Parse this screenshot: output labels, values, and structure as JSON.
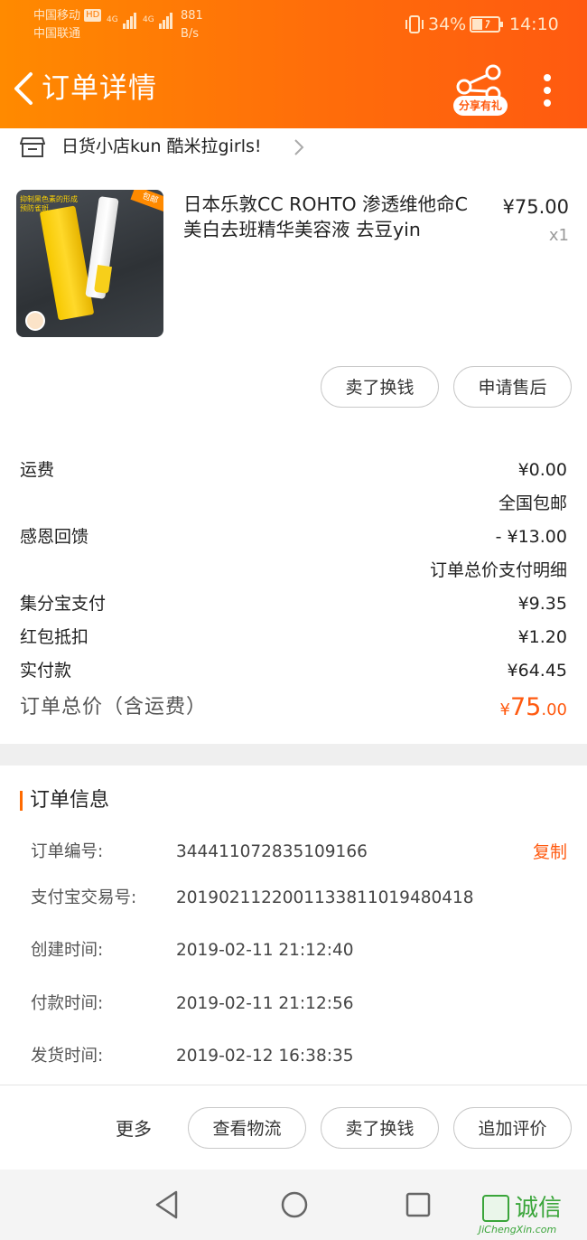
{
  "status_bar": {
    "carrier1": "中国移动",
    "carrier1_badge": "HD",
    "carrier2": "中国联通",
    "net_type1": "4G",
    "net_type2": "4G",
    "speed_value": "881",
    "speed_unit": "B/s",
    "battery": "34%",
    "time": "14:10"
  },
  "header": {
    "title": "订单详情",
    "share_badge": "分享有礼"
  },
  "shop": {
    "name": "日货小店kun 酷米拉girls!"
  },
  "product": {
    "title": "日本乐敦CC ROHTO 渗透维他命C 美白去班精华美容液 去豆yin",
    "price": "¥75.00",
    "qty": "x1",
    "image_text_tag": "抑制黑色素的形成\n预防雀斑",
    "image_corner_tag": "包邮"
  },
  "product_actions": {
    "sell_label": "卖了换钱",
    "aftersale_label": "申请售后"
  },
  "summary": {
    "shipping_label": "运费",
    "shipping_value": "¥0.00",
    "shipping_note": "全国包邮",
    "discount_label": "感恩回馈",
    "discount_value": "- ¥13.00",
    "payment_detail_title": "订单总价支付明细",
    "jifenbao_label": "集分宝支付",
    "jifenbao_value": "¥9.35",
    "hongbao_label": "红包抵扣",
    "hongbao_value": "¥1.20",
    "paid_label": "实付款",
    "paid_value": "¥64.45",
    "total_label": "订单总价（含运费）",
    "total_currency": "¥",
    "total_int": "75",
    "total_dec": ".00"
  },
  "order_info": {
    "title": "订单信息",
    "copy_label": "复制",
    "rows": [
      {
        "key": "订单编号:",
        "value": "344411072835109166"
      },
      {
        "key": "支付宝交易号:",
        "value": "2019021122001133811019480418"
      },
      {
        "key": "创建时间:",
        "value": "2019-02-11 21:12:40"
      },
      {
        "key": "付款时间:",
        "value": "2019-02-11 21:12:56"
      },
      {
        "key": "发货时间:",
        "value": "2019-02-12 16:38:35"
      }
    ]
  },
  "bottom_bar": {
    "more_label": "更多",
    "logistics_label": "查看物流",
    "sell_label": "卖了换钱",
    "review_label": "追加评价"
  },
  "watermark": {
    "cn": "诚信",
    "en": "JiChengXin.com"
  },
  "colors": {
    "header_gradient_start": "#ff8a00",
    "header_gradient_end": "#ff5a10",
    "accent": "#ff5a10",
    "section_gap": "#efefef"
  },
  "icons": [
    "back-arrow-icon",
    "share-icon",
    "more-vertical-icon",
    "shop-icon",
    "chevron-right-icon",
    "nav-back-icon",
    "nav-home-icon",
    "nav-recents-icon"
  ]
}
